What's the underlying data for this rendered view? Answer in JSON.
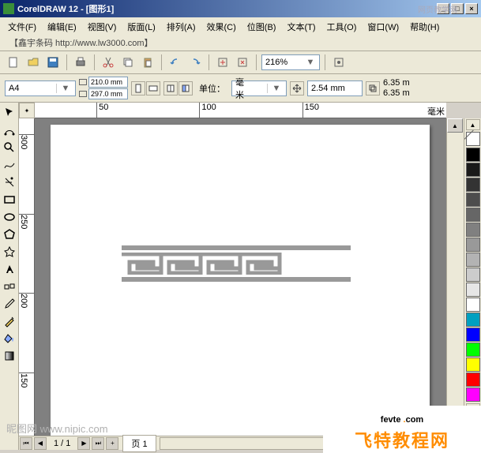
{
  "window": {
    "title": "CorelDRAW 12 - [图形1]",
    "top_watermark": "网页教学网"
  },
  "menu": {
    "file": "文件(F)",
    "edit": "编辑(E)",
    "view": "视图(V)",
    "layout": "版面(L)",
    "arrange": "排列(A)",
    "effects": "效果(C)",
    "bitmap": "位图(B)",
    "text": "文本(T)",
    "tools": "工具(O)",
    "window": "窗口(W)",
    "help": "帮助(H)",
    "link": "【鑫宇条码 http://www.lw3000.com】"
  },
  "toolbar": {
    "zoom": "216%"
  },
  "property": {
    "paper": "A4",
    "width": "210.0 mm",
    "height": "297.0 mm",
    "unit_label": "单位：",
    "unit": "毫米",
    "nudge": "2.54 mm",
    "dup_x": "6.35 m",
    "dup_y": "6.35 m"
  },
  "ruler": {
    "h_label": "毫米",
    "h_ticks": [
      "50",
      "100",
      "150"
    ],
    "v_ticks": [
      "300",
      "250",
      "200",
      "150"
    ]
  },
  "pagenav": {
    "pages": "1 / 1",
    "tab": "页 1"
  },
  "palette_colors": [
    "#000000",
    "#1a1a1a",
    "#333333",
    "#4d4d4d",
    "#666666",
    "#808080",
    "#999999",
    "#b3b3b3",
    "#cccccc",
    "#e6e6e6",
    "#ffffff",
    "#00a0c0",
    "#0000ff",
    "#00ff00",
    "#ffff00",
    "#ff0000",
    "#ff00ff"
  ],
  "watermark": "昵图网 www.nipic.com",
  "brand": {
    "line1": "fevte",
    "dot": " .",
    "line1b": "com",
    "line2": "飞特教程网"
  }
}
